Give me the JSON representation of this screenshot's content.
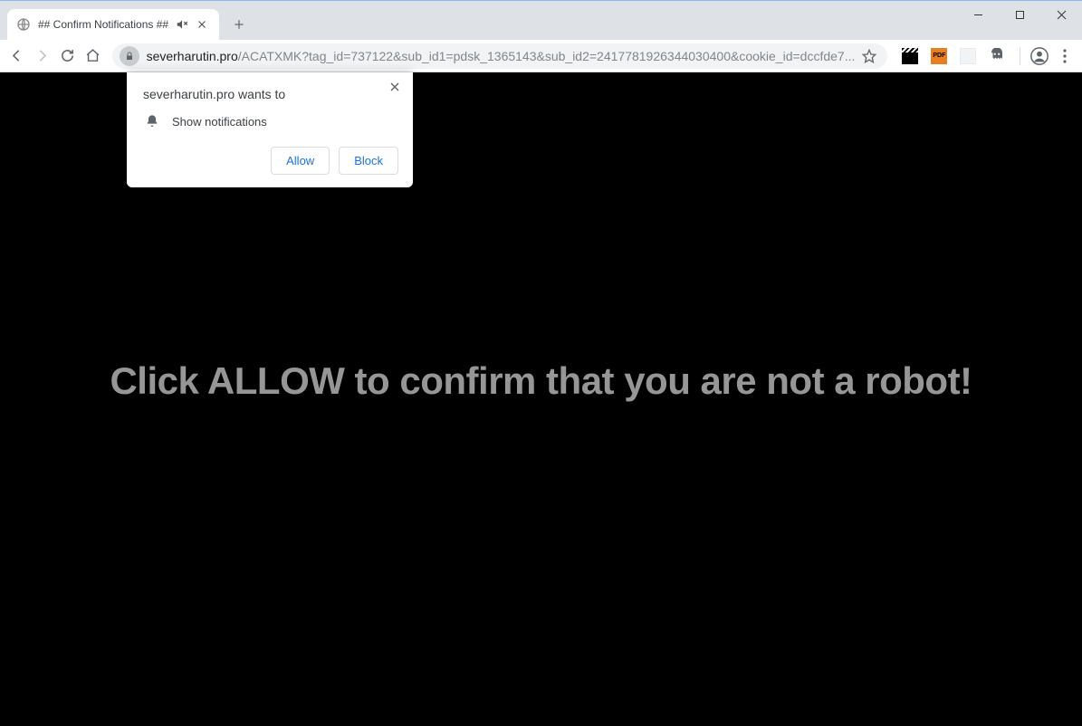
{
  "tab": {
    "title": "## Confirm Notifications ##"
  },
  "address": {
    "host": "severharutin.pro",
    "path": "/ACATXMK?tag_id=737122&sub_id1=pdsk_1365143&sub_id2=2417781926344030400&cookie_id=dccfde7..."
  },
  "extensions": {
    "pdf_label": "PDF"
  },
  "permission": {
    "title": "severharutin.pro wants to",
    "request": "Show notifications",
    "allow": "Allow",
    "block": "Block"
  },
  "page": {
    "hero": "Click ALLOW to confirm that you are not a robot!"
  }
}
